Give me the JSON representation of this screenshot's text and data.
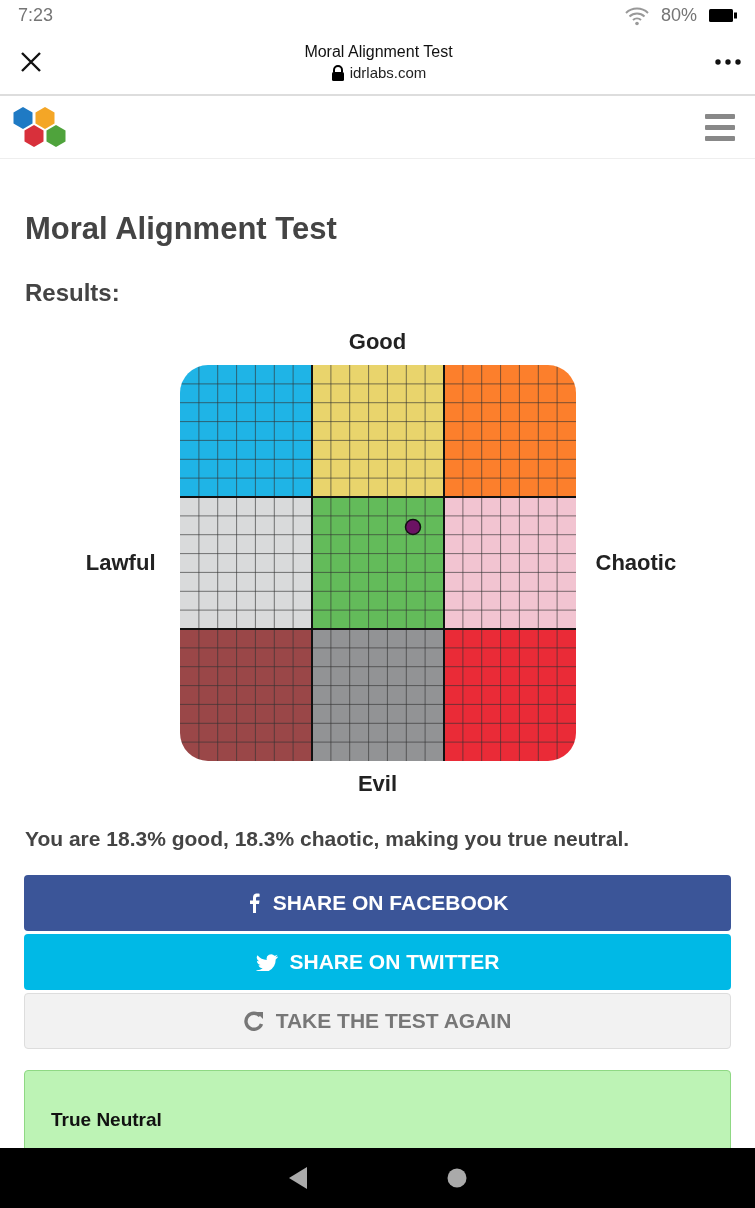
{
  "status_bar": {
    "time": "7:23",
    "battery": "80%"
  },
  "browser": {
    "title": "Moral Alignment Test",
    "url": "idrlabs.com"
  },
  "page": {
    "heading": "Moral Alignment Test",
    "subheading": "Results:"
  },
  "chart": {
    "top_label": "Good",
    "left_label": "Lawful",
    "right_label": "Chaotic",
    "bottom_label": "Evil",
    "cells": [
      {
        "color": "#1fb4e6"
      },
      {
        "color": "#e9d46c"
      },
      {
        "color": "#fc7f2c"
      },
      {
        "color": "#d9dadb"
      },
      {
        "color": "#63bb5a"
      },
      {
        "color": "#f2c4d1"
      },
      {
        "color": "#9a4748"
      },
      {
        "color": "#929395"
      },
      {
        "color": "#ea2b37"
      }
    ]
  },
  "result_text": "You are 18.3% good, 18.3% chaotic, making you true neutral.",
  "buttons": [
    {
      "kind": "facebook",
      "label": "SHARE ON FACEBOOK"
    },
    {
      "kind": "twitter",
      "label": "SHARE ON TWITTER"
    },
    {
      "kind": "retry",
      "label": "TAKE THE TEST AGAIN"
    }
  ],
  "result_card": {
    "title": "True Neutral"
  }
}
